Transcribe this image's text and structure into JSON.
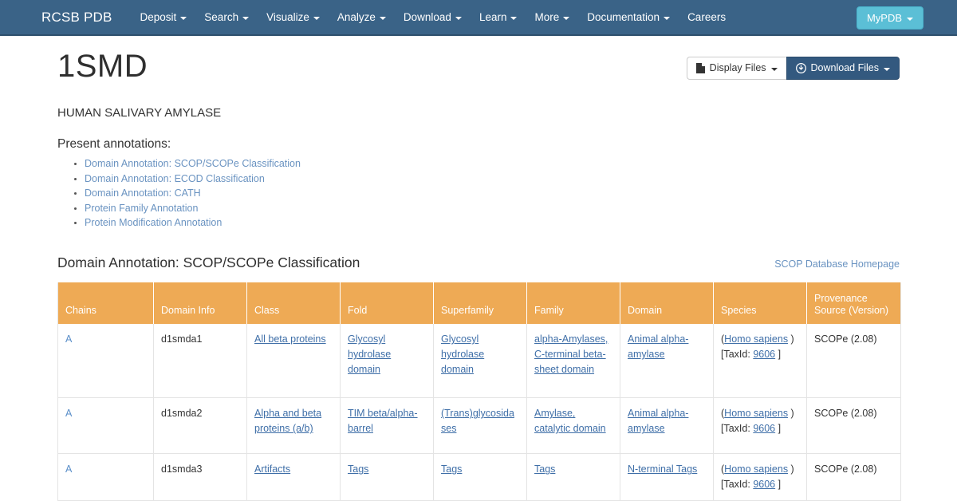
{
  "navbar": {
    "brand": "RCSB PDB",
    "items": [
      {
        "label": "Deposit",
        "caret": true
      },
      {
        "label": "Search",
        "caret": true
      },
      {
        "label": "Visualize",
        "caret": true
      },
      {
        "label": "Analyze",
        "caret": true
      },
      {
        "label": "Download",
        "caret": true
      },
      {
        "label": "Learn",
        "caret": true
      },
      {
        "label": "More",
        "caret": true
      },
      {
        "label": "Documentation",
        "caret": true
      },
      {
        "label": "Careers",
        "caret": false
      }
    ],
    "mypdb_label": "MyPDB",
    "background_color": "#3a6387",
    "mypdb_color": "#5bbfd6"
  },
  "header": {
    "pdb_id": "1SMD",
    "structure_title": "HUMAN SALIVARY AMYLASE",
    "display_files_label": "Display Files",
    "download_files_label": "Download Files"
  },
  "annotations": {
    "heading": "Present annotations:",
    "items": [
      "Domain Annotation: SCOP/SCOPe Classification",
      "Domain Annotation: ECOD Classification",
      "Domain Annotation: CATH",
      "Protein Family Annotation",
      "Protein Modification Annotation"
    ]
  },
  "section": {
    "title": "Domain Annotation: SCOP/SCOPe Classification",
    "external_link": "SCOP Database Homepage",
    "header_color": "#eeaa55"
  },
  "table": {
    "columns": [
      "Chains",
      "Domain Info",
      "Class",
      "Fold",
      "Superfamily",
      "Family",
      "Domain",
      "Species",
      "Provenance Source (Version)"
    ],
    "column_provenance_line1": "Provenance",
    "column_provenance_line2": "Source (Version)",
    "rows": [
      {
        "chains": "A",
        "domain_info": "d1smda1",
        "class": "All beta proteins",
        "fold": "Glycosyl hydrolase domain",
        "superfamily": "Glycosyl hydrolase domain",
        "family": "alpha-Amylases, C-terminal beta-sheet domain",
        "domain": "Animal alpha-amylase",
        "species_name": "Homo sapiens",
        "species_taxid_label": "[TaxId:",
        "species_taxid": "9606",
        "provenance": "SCOPe (2.08)"
      },
      {
        "chains": "A",
        "domain_info": "d1smda2",
        "class": "Alpha and beta proteins (a/b)",
        "fold": "TIM beta/alpha-barrel",
        "superfamily": "(Trans)glycosidases",
        "family": "Amylase, catalytic domain",
        "domain": "Animal alpha-amylase",
        "species_name": "Homo sapiens",
        "species_taxid_label": "[TaxId:",
        "species_taxid": "9606",
        "provenance": "SCOPe (2.08)"
      },
      {
        "chains": "A",
        "domain_info": "d1smda3",
        "class": "Artifacts",
        "fold": "Tags",
        "superfamily": "Tags",
        "family": "Tags",
        "domain": "N-terminal Tags",
        "species_name": "Homo sapiens",
        "species_taxid_label": "[TaxId:",
        "species_taxid": "9606",
        "provenance": "SCOPe (2.08)"
      }
    ]
  }
}
